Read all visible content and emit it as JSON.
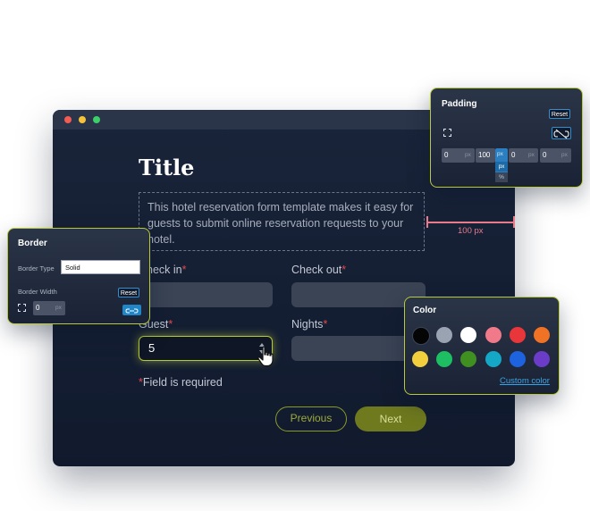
{
  "form": {
    "title": "Title",
    "description": "This hotel reservation form template makes it easy for guests to submit online reservation requests to your hotel.",
    "check_in_label": "Check in",
    "check_out_label": "Check out",
    "guest_label": "Guest",
    "nights_label": "Nights",
    "required_mark": "*",
    "guest_value": "5",
    "required_note": "Field is required",
    "previous_label": "Previous",
    "next_label": "Next",
    "padding_measure": "100 px"
  },
  "padding_panel": {
    "title": "Padding",
    "reset_label": "Reset",
    "fields": [
      {
        "value": "0",
        "unit": "px"
      },
      {
        "value": "100",
        "unit": "px"
      },
      {
        "value": "0",
        "unit": "px"
      },
      {
        "value": "0",
        "unit": "px"
      }
    ],
    "unit_options": [
      "px",
      "%"
    ]
  },
  "border_panel": {
    "title": "Border",
    "type_label": "Border Type",
    "type_value": "Solid",
    "width_label": "Border Width",
    "width_value": "0",
    "width_unit": "px",
    "reset_label": "Reset"
  },
  "color_panel": {
    "title": "Color",
    "custom_label": "Custom color",
    "swatches": [
      "#050505",
      "#9aa3b2",
      "#ffffff",
      "#f07a8a",
      "#e8363a",
      "#f07325",
      "#f2cf3c",
      "#1dbf62",
      "#3f8f21",
      "#14a8c6",
      "#1d63e0",
      "#6b3cc8"
    ]
  },
  "colors": {
    "accent": "#b9c93a",
    "required": "#e5484d",
    "link": "#3aa3e6",
    "measure": "#e87a8a"
  }
}
